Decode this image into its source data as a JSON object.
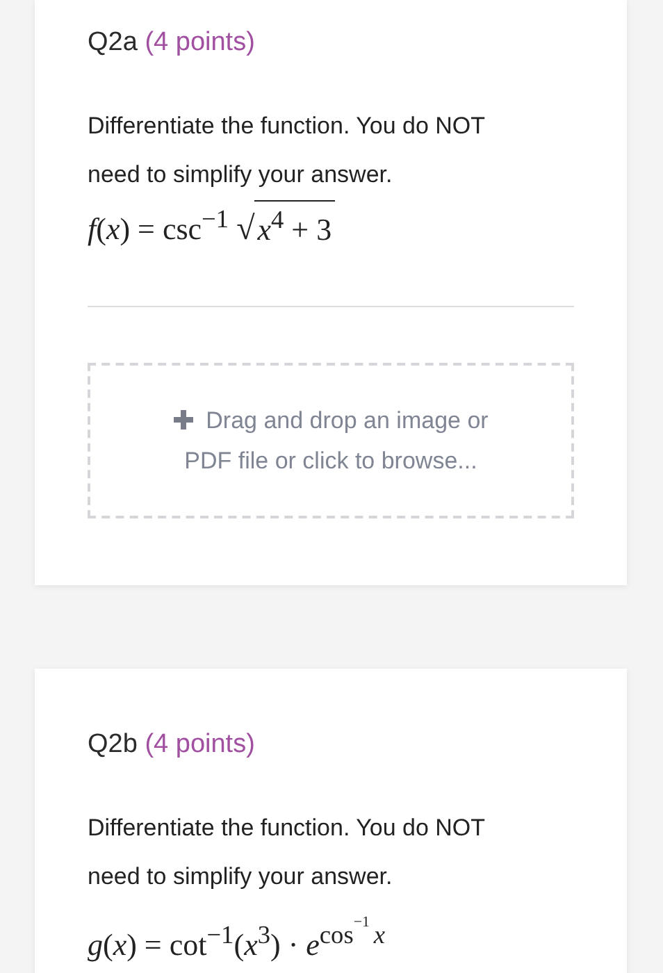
{
  "questions": [
    {
      "label": "Q2a",
      "points": "(4 points)",
      "prompt": "Differentiate the function. You do NOT need to simplify your answer.",
      "formula": [
        {
          "kind": "text",
          "text": "*f*(*x*) = csc$^{−1}$ "
        },
        {
          "kind": "sqrt",
          "sign": "√",
          "text": "*x*$^{4}$ + 3"
        }
      ],
      "upload": {
        "text": "Drag and drop an image or PDF file or click to browse..."
      }
    },
    {
      "label": "Q2b",
      "points": "(4 points)",
      "prompt": "Differentiate the function. You do NOT need to simplify your answer.",
      "formula": [
        {
          "kind": "text",
          "text": "*g*(*x*) = cot$^{−1}$(*x*$^{3}$) · *e*$^{cos}$"
        },
        {
          "kind": "sup",
          "text": "$^{−1}$"
        },
        {
          "kind": "italic",
          "text": "$^{x}$"
        }
      ]
    }
  ]
}
